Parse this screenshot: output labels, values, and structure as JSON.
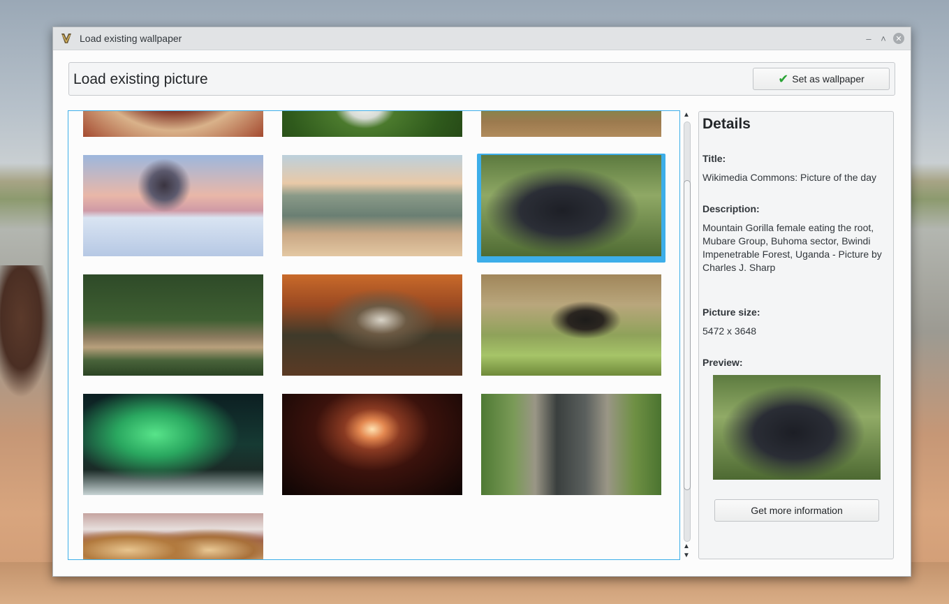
{
  "window": {
    "title": "Load existing wallpaper",
    "minimize_glyph": "–",
    "maximize_glyph": "˄",
    "close_glyph": "✕"
  },
  "header": {
    "title": "Load existing picture",
    "set_wallpaper_button": "Set as wallpaper"
  },
  "grid": {
    "thumbnails": [
      {
        "id": "t0",
        "subject": "mandala-partial"
      },
      {
        "id": "t1",
        "subject": "white-flower-partial"
      },
      {
        "id": "t2",
        "subject": "green-plant-partial"
      },
      {
        "id": "t3",
        "subject": "frosted-thistle"
      },
      {
        "id": "t4",
        "subject": "buffalo-river-sunset"
      },
      {
        "id": "t5",
        "subject": "mountain-gorilla",
        "selected": true
      },
      {
        "id": "t6",
        "subject": "chameleon-on-branch"
      },
      {
        "id": "t7",
        "subject": "forest-waterfall"
      },
      {
        "id": "t8",
        "subject": "grasshopper-on-leaf"
      },
      {
        "id": "t9",
        "subject": "aurora-borealis"
      },
      {
        "id": "t10",
        "subject": "glowing-fractal-bowl"
      },
      {
        "id": "t11",
        "subject": "stone-water-channel"
      },
      {
        "id": "t12",
        "subject": "bread-loaves-partial"
      }
    ]
  },
  "details": {
    "heading": "Details",
    "title_label": "Title:",
    "title_value": "Wikimedia Commons: Picture of the day",
    "description_label": "Description:",
    "description_value": "Mountain Gorilla female eating the root, Mubare Group, Buhoma sector, Bwindi Impenetrable Forest, Uganda - Picture by Charles J. Sharp",
    "size_label": "Picture size:",
    "size_value": "5472 x 3648",
    "preview_label": "Preview:",
    "more_info_button": "Get more information"
  },
  "colors": {
    "accent": "#3daee9",
    "check": "#2aa335"
  }
}
